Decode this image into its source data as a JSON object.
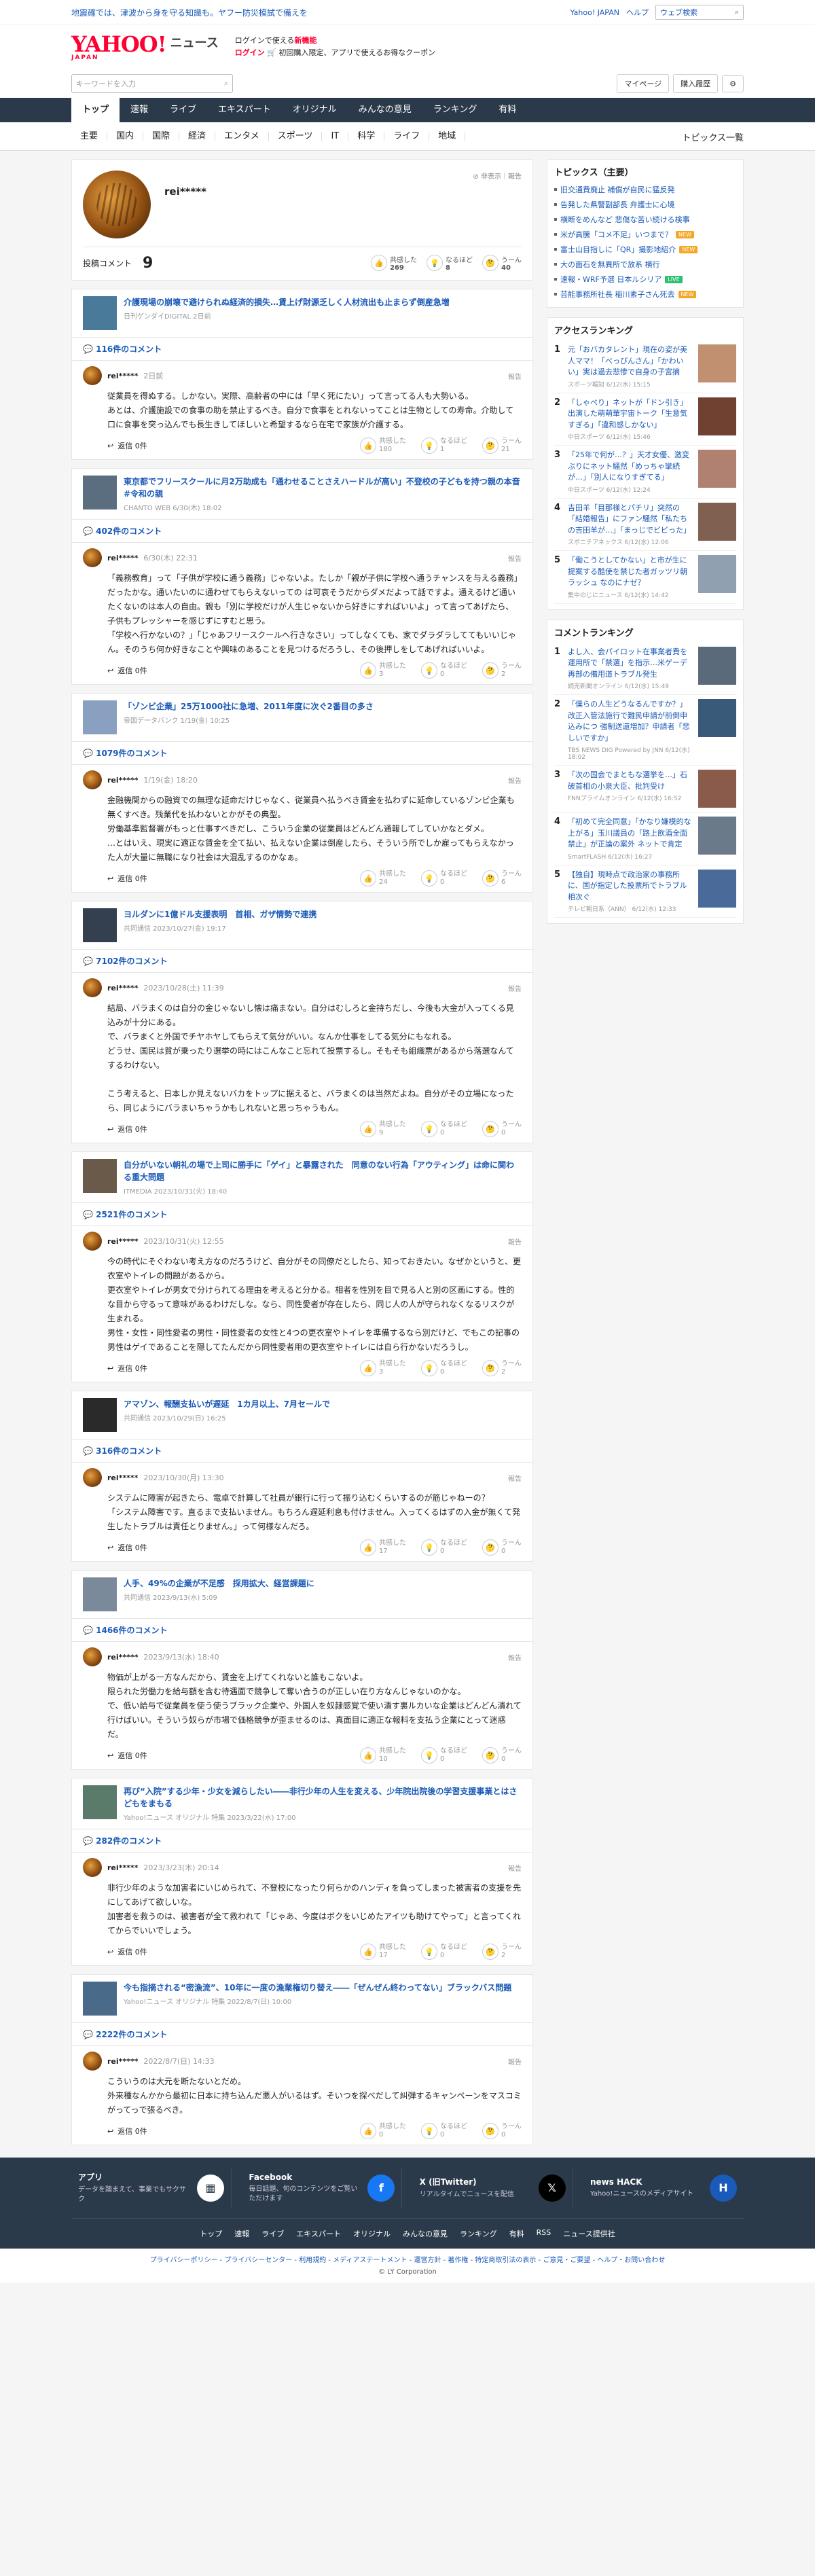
{
  "topbar": {
    "notice": "地震確では、津波から身を守る知識も。ヤフー防災模試で備えを",
    "yahoo_japan": "Yahoo! JAPAN",
    "help": "ヘルプ",
    "search_placeholder": "ウェブ検索"
  },
  "masthead": {
    "logo": "YAHOO!",
    "logo_sub": "JAPAN",
    "service": "ニュース",
    "promo_line1": "ログインで使える",
    "promo_bold": "新機能",
    "promo_line2": "ログイン",
    "promo_line3": "初回購入限定、アプリで使えるお得なクーポン"
  },
  "search": {
    "placeholder": "キーワードを入力",
    "mypage": "マイページ",
    "history": "購入履歴"
  },
  "nav": {
    "tabs": [
      "トップ",
      "速報",
      "ライブ",
      "エキスパート",
      "オリジナル",
      "みんなの意見",
      "ランキング",
      "有料"
    ]
  },
  "subnav": {
    "items": [
      "主要",
      "国内",
      "国際",
      "経済",
      "エンタメ",
      "スポーツ",
      "IT",
      "科学",
      "ライフ",
      "地域"
    ],
    "more": "トピックス一覧"
  },
  "profile": {
    "name": "rei*****",
    "hide": "非表示",
    "report": "報告",
    "comment_label": "投稿コメント",
    "comment_count": "9",
    "r1_label": "共感した",
    "r1_count": "269",
    "r2_label": "なるほど",
    "r2_count": "8",
    "r3_label": "うーん",
    "r3_count": "40"
  },
  "reply_label": "返信 0件",
  "react_labels": [
    "共感した",
    "なるほど",
    "うーん"
  ],
  "report_label": "報告",
  "entries": [
    {
      "title": "介護現場の崩壊で避けられぬ経済的損失…賃上げ財源乏しく人材流出も止まらず倒産急増",
      "meta": "日刊ゲンダイDIGITAL 2日前",
      "ccount": "116件のコメント",
      "user": "rei*****",
      "date": "2日前",
      "text": "従業員を得ぬする。しかない。実際、高齢者の中には「早く死にたい」って言ってる人も大勢いる。\nあとは、介護施設での食事の助を禁止するべき。自分で食事をとれないってことは生物としての寿命。介助して口に食事を突っ込んでも長生きしてほしいと希望するなら在宅で家族が介護する。",
      "c1": "180",
      "c2": "1",
      "c3": "21"
    },
    {
      "title": "東京都でフリースクールに月2万助成も「通わせることさえハードルが高い」不登校の子どもを持つ親の本音 #令和の親",
      "meta": "CHANTO WEB 6/30(木) 18:02",
      "ccount": "402件のコメント",
      "user": "rei*****",
      "date": "6/30(木) 22:31",
      "text": "「義務教育」って「子供が学校に通う義務」じゃないよ。たしか「親が子供に学校へ通うチャンスを与える義務」だったかな。通いたいのに通わせてもらえないっての は可哀そうだからダメだよって話ですよ。通えるけど通いたくないのは本人の自由。親も「別に学校だけが人生じゃないから好きにすればいいよ」って言ってあげたら、子供もプレッシャーを感じずにすむと思う。\n「学校へ行かないの？」「じゃあフリースクールへ行きなさい」ってしなくても、家でダラダラしててもいいじゃん。そのうち何か好きなことや興味のあることを見つけるだろうし、その後押しをしてあげればいいよ。",
      "c1": "3",
      "c2": "0",
      "c3": "2"
    },
    {
      "title": "「ゾンビ企業」25万1000社に急増、2011年度に次ぐ2番目の多さ",
      "meta": "帝国データバンク 1/19(金) 10:25",
      "ccount": "1079件のコメント",
      "user": "rei*****",
      "date": "1/19(金) 18:20",
      "text": "金融機関からの融資での無理な延命だけじゃなく、従業員へ払うべき賃金を払わずに延命しているゾンビ企業も無くすべき。残業代を払わないとかがその典型。\n労働基準監督署がもっと仕事すべきだし、こういう企業の従業員はどんどん通報してしていかなとダメ。\n…とはいえ、現実に適正な賃金を全て払い、払えない企業は倒産したら、そういう所でしか雇ってもらえなかった人が大量に無職になり社会は大混乱するのかなぁ。",
      "c1": "24",
      "c2": "0",
      "c3": "6"
    },
    {
      "title": "ヨルダンに1億ドル支援表明　首相、ガザ情勢で連携",
      "meta": "共同通信 2023/10/27(金) 19:17",
      "ccount": "7102件のコメント",
      "user": "rei*****",
      "date": "2023/10/28(土) 11:39",
      "text": "結局、バラまくのは自分の金じゃないし懐は痛まない。自分はむしろと金持ちだし、今後も大金が入ってくる見込みが十分にある。\nで、バラまくと外国でチヤホヤしてもらえて気分がいい。なんか仕事をしてる気分にもなれる。\nどうせ、国民は貧が乗ったり選挙の時にはこんなこと忘れて投票するし。そもそも組織票があるから落選なんてするわけない。\n\nこう考えると、日本しか見えないバカをトップに据えると、バラまくのは当然だよね。自分がその立場になったら、同じようにバラまいちゃうかもしれないと思っちゃうもん。",
      "c1": "9",
      "c2": "0",
      "c3": "0"
    },
    {
      "title": "自分がいない朝礼の場で上司に勝手に「ゲイ」と暴露された　同意のない行為「アウティング」は命に関わる重大問題",
      "meta": "ITMEDIA 2023/10/31(火) 18:40",
      "ccount": "2521件のコメント",
      "user": "rei*****",
      "date": "2023/10/31(火) 12:55",
      "text": "今の時代にそぐわない考え方なのだろうけど、自分がその同僚だとしたら、知っておきたい。なぜかというと、更衣室やトイレの問題があるから。\n更衣室やトイレが男女で分けられてる理由を考えると分かる。相者を性別を目で見る人と別の区画にする。性的な目から守るって意味があるわけだしな。なら、同性愛者が存在したら、同じ人の人が守られなくなるリスクが生まれる。\n男性・女性・同性愛者の男性・同性愛者の女性と4つの更衣室やトイレを準備するなら別だけど、でもこの記事の男性はゲイであることを隠してたんだから同性愛者用の更衣室やトイレには自ら行かないだろうし。",
      "c1": "3",
      "c2": "0",
      "c3": "2"
    },
    {
      "title": "アマゾン、報酬支払いが遅延　1カ月以上、7月セールで",
      "meta": "共同通信 2023/10/29(日) 16:25",
      "ccount": "316件のコメント",
      "user": "rei*****",
      "date": "2023/10/30(月) 13:30",
      "text": "システムに障害が起きたら、電卓で計算して社員が銀行に行って振り込むくらいするのが筋じゃねーの？\n「システム障害です。直るまで支払いません。もちろん遅延利息も付けません。入ってくるはずの入金が無くて発生したトラブルは責任とりません。」って何様なんだろ。",
      "c1": "17",
      "c2": "0",
      "c3": "0"
    },
    {
      "title": "人手、49%の企業が不足感　採用拡大、経営課題に",
      "meta": "共同通信 2023/9/13(水) 5:09",
      "ccount": "1466件のコメント",
      "user": "rei*****",
      "date": "2023/9/13(水) 18:40",
      "text": "物価が上がる一方なんだから、賃金を上げてくれないと誰もこないよ。\n限られた労働力を給与額を含む待遇面で競争して奪い合うのが正しい在り方なんじゃないのかな。\nで、低い給与で従業員を使う使うブラック企業や、外国人を奴隷感覚で使い潰す裏ルカいな企業はどんどん潰れて行けばいい。そういう奴らが市場で価格競争が歪ませるのは、真面目に適正な報料を支払う企業にとって迷惑だ。",
      "c1": "10",
      "c2": "0",
      "c3": "0"
    },
    {
      "title": "再び“入院”する少年・少女を減らしたい――非行少年の人生を変える、少年院出院後の学習支援事業とはさどもをまもる",
      "meta": "Yahoo!ニュース オリジナル 特集 2023/3/22(水) 17:00",
      "ccount": "282件のコメント",
      "user": "rei*****",
      "date": "2023/3/23(木) 20:14",
      "text": "非行少年のような加害者にいじめられて、不登校になったり何らかのハンディを負ってしまった被害者の支援を先にしてあげて欲しいな。\n加害者を救うのは、被害者が全て救われて「じゃあ、今度はボクをいじめたアイツも助けてやって」と言ってくれてからでいいでしょう。",
      "c1": "17",
      "c2": "0",
      "c3": "2"
    },
    {
      "title": "今も指摘される“密漁流”、10年に一度の漁業権切り替え――「ぜんぜん終わってない」ブラックバス問題",
      "meta": "Yahoo!ニュース オリジナル 特集 2022/8/7(日) 10:00",
      "ccount": "2222件のコメント",
      "user": "rei*****",
      "date": "2022/8/7(日) 14:33",
      "text": "こういうのは大元を断たないとだめ。\n外来種なんかから最初に日本に持ち込んだ悪人がいるはず。そいつを探べだして糾弾するキャンペーンをマスコミがってっで張るべき。",
      "c1": "0",
      "c2": "0",
      "c3": "0"
    }
  ],
  "sidebar": {
    "topics_title": "トピックス（主要）",
    "topics": [
      {
        "t": "旧交通費廃止 補償が自民に猛反発",
        "tag": ""
      },
      {
        "t": "告発した県警副部長 弁護士に心境",
        "tag": ""
      },
      {
        "t": "横断をめんなど 悲傷な苦い続ける検事",
        "tag": ""
      },
      {
        "t": "米が高騰「コメ不足」いつまで？",
        "tag": "NEW"
      },
      {
        "t": "富士山目指しに「QR」撮影地紹介",
        "tag": "NEW"
      },
      {
        "t": "大の面石を無異所で放系 横行",
        "tag": ""
      },
      {
        "t": "速報・WRF予選 日本ルシリア",
        "tag": "LIVE"
      },
      {
        "t": "芸能事務所社長 稲川素子さん死去",
        "tag": "NEW"
      }
    ],
    "access_title": "アクセスランキング",
    "access": [
      {
        "t": "元「おバカタレント」現在の姿が美人ママ！「べっぴんさん」「かわいい」実は過去悲惨で自身の子宮摘",
        "m": "スポーツ報知 6/12(水) 15:15"
      },
      {
        "t": "「しゃべり」ネットが「ドン引き」出演した萌萌華宇宙トーク「生意気すぎる」「違和感しかない」",
        "m": "中日スポーツ 6/12(水) 15:46"
      },
      {
        "t": "「25年で何が…？」天才女優、激変ぶりにネット騒然「めっちゃ攣続が…」「別人になりすぎてる」",
        "m": "中日スポーツ 6/12(水) 12:24"
      },
      {
        "t": "吉田羊「目那様とパチリ」突然の「結婚報告」にファン騒然「私たちの吉田羊が…」「まっじでビビった」",
        "m": "スポニチアネックス 6/12(水) 12:06"
      },
      {
        "t": "「働こうとしてかない」と市が生に提案する酷使を禁じた者ガッツリ朝ラッシュ なのにナゼ？",
        "m": "集中のじにニュース 6/12(水) 14:42"
      }
    ],
    "comment_title": "コメントランキング",
    "comments": [
      {
        "t": "よし入、会パイロット在事業者費を運用所で「禁選」を指示…米ゲーデ再部の備用道トラブル発生",
        "m": "読売新聞オンライン 6/12(水) 15:49"
      },
      {
        "t": "「僕らの人生どうなるんですか？」改正入管法施行で難民申請が前倒申込みにつ 強制送還増加？申請者「悲しいですか」",
        "m": "TBS NEWS DIG Powered by JNN 6/12(水) 18:02"
      },
      {
        "t": "「次の国会でまともな選挙を…」石破首相の小泉大臣、批判受け",
        "m": "FNNプライムオンライン 6/12(水) 16:52"
      },
      {
        "t": "「初めて完全同意」「かなり嫌模的な上がる」玉川議員の「路上飲酒全面禁止」が正論の案外 ネットで肯定",
        "m": "SmartFLASH 6/12(水) 16:27"
      },
      {
        "t": "【独自】現時点で政治家の事務所に、国が指定した投票所でトラブル相次ぐ",
        "m": "テレビ朝日系（ANN） 6/12(水) 12:33"
      }
    ]
  },
  "footer": {
    "cards": [
      {
        "title": "アプリ",
        "desc": "データを踏まえて、事業でもサクサク",
        "icon": "app-icon"
      },
      {
        "title": "Facebook",
        "desc": "毎日話題、旬のコンテンツをご覧いただけます",
        "icon": "facebook-icon"
      },
      {
        "title": "X (旧Twitter)",
        "desc": "リアルタイムでニュースを配信",
        "icon": "x-icon"
      },
      {
        "title": "news HACK",
        "desc": "Yahoo!ニュースのメディアサイト",
        "icon": "newshack-icon"
      }
    ],
    "links": [
      "トップ",
      "速報",
      "ライブ",
      "エキスパート",
      "オリジナル",
      "みんなの意見",
      "ランキング",
      "有料",
      "RSS",
      "ニュース提供社"
    ],
    "policy": "プライバシーポリシー - プライバシーセンター - 利用規約 - メディアステートメント - 運営方針 - 著作権 - 特定商取引法の表示 - ご意見・ご要望 - ヘルプ・お問い合わせ",
    "copyright": "© LY Corporation"
  }
}
